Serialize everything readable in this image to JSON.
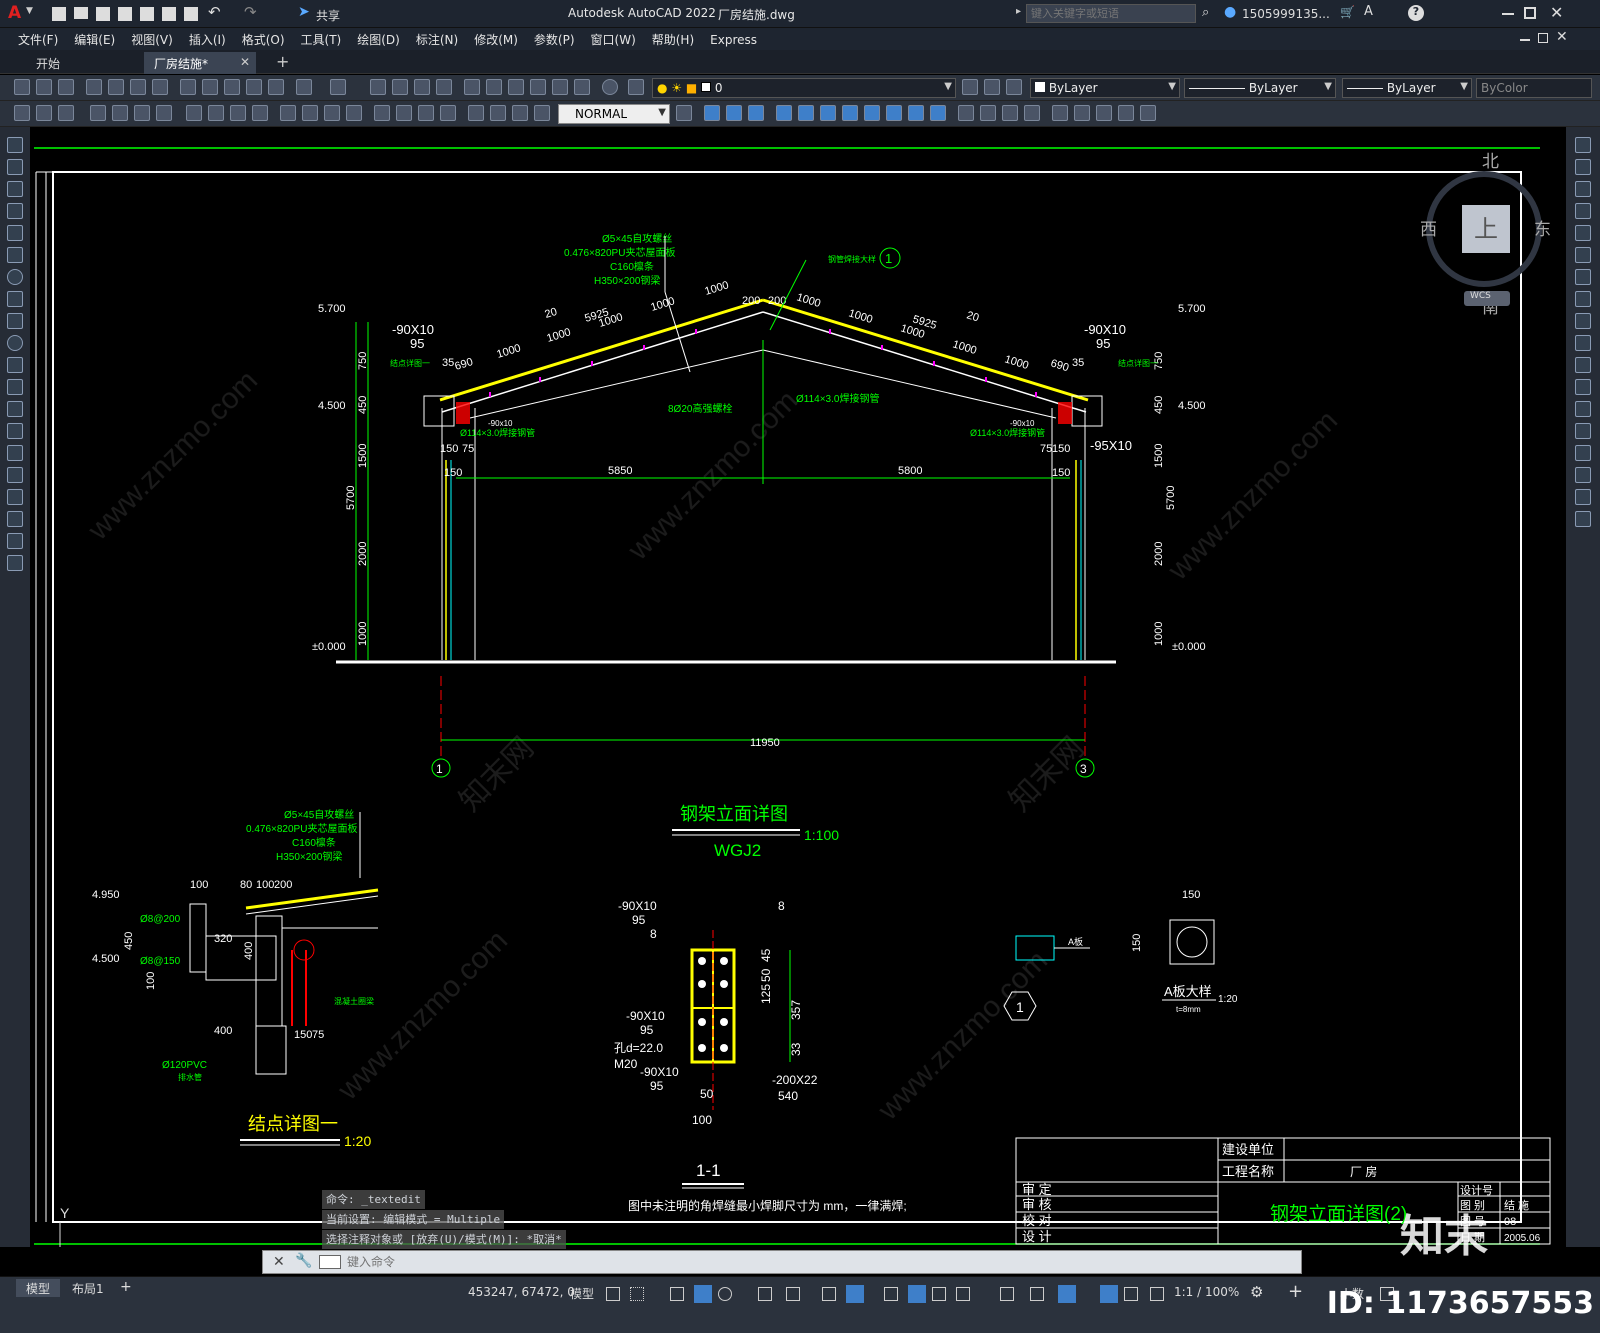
{
  "app": {
    "logo": "A",
    "title": "Autodesk AutoCAD 2022",
    "filename": "厂房结施.dwg",
    "share_label": "共享",
    "search_placeholder": "键入关键字或短语",
    "user": "1505999135...",
    "help_icon": "?"
  },
  "menu": [
    "文件(F)",
    "编辑(E)",
    "视图(V)",
    "插入(I)",
    "格式(O)",
    "工具(T)",
    "绘图(D)",
    "标注(N)",
    "修改(M)",
    "参数(P)",
    "窗口(W)",
    "帮助(H)",
    "Express"
  ],
  "tabs": [
    "开始",
    "厂房结施*"
  ],
  "toolbar": {
    "layer_value": "0",
    "color_value": "ByLayer",
    "linetype_value": "ByLayer",
    "lineweight_value": "ByLayer",
    "plotstyle_value": "ByColor",
    "textstyle_value": "NORMAL"
  },
  "viewcube": {
    "north": "北",
    "south": "南",
    "east": "东",
    "west": "西",
    "top": "上",
    "wcs": "WCS"
  },
  "drawing": {
    "main_title": "钢架立面详图",
    "main_subtitle": "WGJ2",
    "main_scale": "1:100",
    "node_title": "结点详图一",
    "node_scale": "1:20",
    "section_title": "1-1",
    "aplate_title": "A板大样",
    "aplate_scale": "1:20",
    "aplate_t": "t=8mm",
    "aplate_dim": "150",
    "aplate_label": "A板",
    "circle_mark": "1",
    "note": "图中未注明的角焊缝最小焊脚尺寸为  mm，一律满焊;",
    "elevations": {
      "top": "5.700",
      "mid": "4.500",
      "zero": "±0.000",
      "n1": "4.950",
      "n2": "4.500"
    },
    "roof_layers": [
      "Ø5×45自攻螺丝",
      "0.476×820PU夹芯屋面板",
      "C160檩条",
      "H350×200钢梁"
    ],
    "dims": {
      "span_left": "5850",
      "span_right": "5800",
      "total": "11950",
      "slope_left": "5925",
      "slope_right": "5925",
      "seg": "1000",
      "end": "690",
      "small": "20",
      "c200": "200",
      "col_h": "5700",
      "d750": "750",
      "d450": "450",
      "d1500": "1500",
      "d2000": "2000",
      "d1000": "1000",
      "d150": "150",
      "d75": "75",
      "d35": "35"
    },
    "labels": {
      "plate_left": "-90X10",
      "plate_left2": "95",
      "plate_right": "-90X10",
      "plate_right2": "95",
      "plate_95": "-95X10",
      "bolts": "8Ø20高强螺栓",
      "pipe": "Ø114×3.0焊接钢管",
      "pipe2": "Ø114×3.0焊接钢管",
      "small_plate": "-90x10",
      "joint_detail": "钢管焊接大样",
      "ridge_ref": "1",
      "axis1": "1",
      "axis3": "3",
      "node_ref_l": "结点详图一",
      "node_ref_r": "结点详图一"
    },
    "section": {
      "plate1": "-90X10",
      "plate1b": "95",
      "w8": "8",
      "plate2": "-90X10",
      "plate2b": "95",
      "hole": "孔d=22.0",
      "bolt": "M20",
      "plate3": "-90X10",
      "plate3b": "95",
      "plate4": "-200X22",
      "plate4b": "540",
      "d50": "50",
      "d100": "100",
      "dims_r": [
        "45",
        "50",
        "125",
        "357",
        "33"
      ]
    },
    "node": {
      "d100": "100",
      "d80": "80",
      "d200": "200",
      "d320": "320",
      "d400": "400",
      "d400b": "400",
      "d450": "450",
      "d100b": "100",
      "d150": "150",
      "d75": "75",
      "rebar1": "Ø8@200",
      "rebar2": "Ø8@150",
      "pvc": "Ø120PVC",
      "pvc2": "排水管",
      "beam": "混凝土圈梁"
    }
  },
  "titleblock": {
    "unit": "建设单位",
    "project": "工程名称",
    "project_value": "厂 房",
    "rows": [
      "审 定",
      "审 核",
      "校 对",
      "设 计"
    ],
    "sheet_title": "钢架立面详图(2)",
    "r1": "设计号",
    "r2": "图 别",
    "r2v": "结 施",
    "r3": "图 号",
    "r3v": "08",
    "r4": "日 期",
    "r4v": "2005.06"
  },
  "command": {
    "history": [
      "命令: _textedit",
      "当前设置: 编辑模式 = Multiple",
      "选择注释对象或 [放弃(U)/模式(M)]: *取消*"
    ],
    "placeholder": "键入命令"
  },
  "status": {
    "layout_tabs": [
      "模型",
      "布局1"
    ],
    "coords": "453247, 67472, 0",
    "model": "模型",
    "scale": "1:1 / 100%",
    "units": "小数"
  },
  "watermarks": {
    "brand": "知末",
    "id": "ID: 1173657553",
    "site": "www.znzmo.com",
    "site_cn": "知末网"
  },
  "colors": {
    "green": "#00ff00",
    "yellow": "#ffff00",
    "white": "#ffffff",
    "magenta": "#ff00ff",
    "cyan": "#00ffff",
    "red": "#ff0000",
    "bg": "#000000",
    "chrome": "#2b323d"
  }
}
